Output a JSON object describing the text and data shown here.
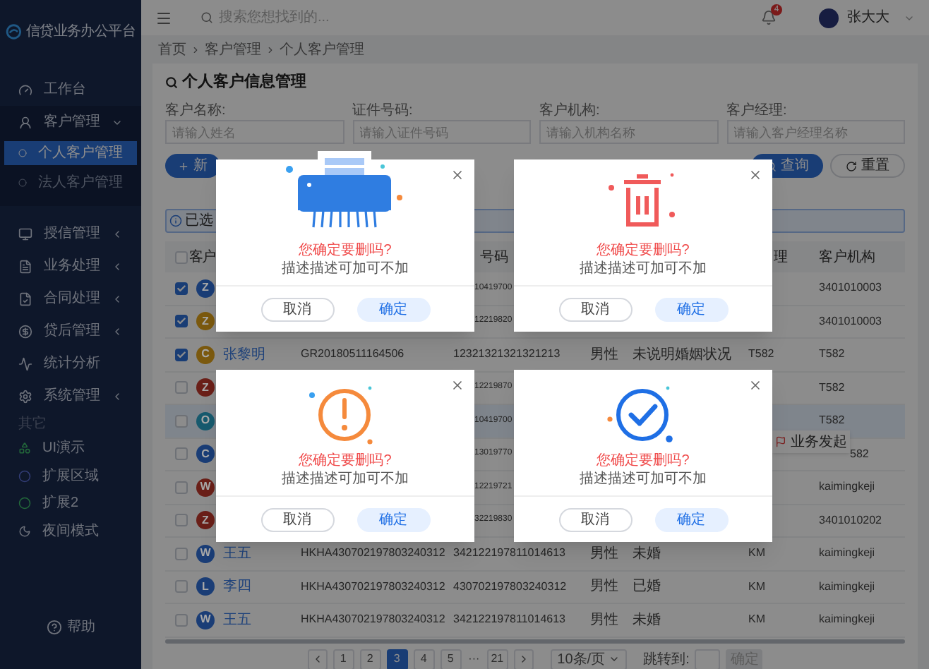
{
  "sidebar": {
    "logo_text": "信贷业务办公平台",
    "items": [
      {
        "label": "工作台",
        "kind": "link",
        "selected": false
      },
      {
        "label": "客户管理",
        "kind": "group",
        "expanded": true,
        "selected": false,
        "children": [
          {
            "label": "个人客户管理",
            "selected": true
          },
          {
            "label": "法人客户管理",
            "selected": false
          }
        ]
      },
      {
        "label": "授信管理",
        "kind": "group",
        "expanded": false,
        "selected": false
      },
      {
        "label": "业务处理",
        "kind": "group",
        "expanded": false,
        "selected": false
      },
      {
        "label": "合同处理",
        "kind": "group",
        "expanded": false,
        "selected": false
      },
      {
        "label": "贷后管理",
        "kind": "group",
        "expanded": false,
        "selected": false
      },
      {
        "label": "统计分析",
        "kind": "link",
        "selected": false
      },
      {
        "label": "系统管理",
        "kind": "group",
        "expanded": false,
        "selected": false
      }
    ],
    "section_title": "其它",
    "extra_items": [
      {
        "label": "UI演示"
      },
      {
        "label": "扩展区域"
      },
      {
        "label": "扩展2"
      },
      {
        "label": "夜间模式"
      }
    ],
    "help": "帮助"
  },
  "header": {
    "search_placeholder": "搜索您想找到的...",
    "notification_count": "4",
    "user_name": "张大大"
  },
  "breadcrumb": [
    "首页",
    "客户管理",
    "个人客户管理"
  ],
  "page_title": "个人客户信息管理",
  "filters": [
    {
      "label": "客户名称:",
      "placeholder": "请输入姓名"
    },
    {
      "label": "证件号码:",
      "placeholder": "请输入证件号码"
    },
    {
      "label": "客户机构:",
      "placeholder": "请输入机构名称"
    },
    {
      "label": "客户经理:",
      "placeholder": "请输入客户经理名称"
    }
  ],
  "actions": {
    "add": "新",
    "query": "查询",
    "reset": "重置"
  },
  "alert": "已选",
  "table": {
    "header_checked": false,
    "columns": [
      {
        "label": "客户"
      },
      {
        "label": "号码"
      },
      {
        "label": "理"
      },
      {
        "label": "客户机构"
      }
    ],
    "rows": [
      {
        "checked": true,
        "highlighted": false,
        "avatar": "Z",
        "color": "#1a3d76",
        "cert_tail": "10419700",
        "org": "3401010003"
      },
      {
        "checked": true,
        "highlighted": false,
        "avatar": "Z",
        "color": "#7b590e",
        "cert_tail": "12219820",
        "org": "3401010003"
      },
      {
        "checked": true,
        "highlighted": false,
        "avatar": "C",
        "color": "#7b590e",
        "name": "张黎明",
        "id_no": "GR20180511164506",
        "cert": "12321321321321213",
        "gender": "男性",
        "marital": "未说明婚姻状况",
        "manager": "T582",
        "org": "T582"
      },
      {
        "checked": false,
        "highlighted": false,
        "avatar": "Z",
        "color": "#6a1f18",
        "cert_tail": "12219870",
        "org": "T582"
      },
      {
        "checked": false,
        "highlighted": true,
        "avatar": "O",
        "color": "#175a6e",
        "cert_tail": "10419700",
        "org": "T582"
      },
      {
        "checked": false,
        "highlighted": false,
        "avatar": "C",
        "color": "#1a3d76",
        "cert_tail": "13019770",
        "org_tail": "582"
      },
      {
        "checked": false,
        "highlighted": false,
        "avatar": "W",
        "color": "#6a1f18",
        "cert_tail": "12219721",
        "org": "kaimingkeji"
      },
      {
        "checked": false,
        "highlighted": false,
        "avatar": "Z",
        "color": "#6a1f18",
        "cert_tail": "32219830",
        "org": "3401010202"
      },
      {
        "checked": false,
        "highlighted": false,
        "avatar": "W",
        "color": "#1a3d76",
        "name": "王五",
        "id_no": "HKHA430702197803240312",
        "cert": "342122197811014613",
        "gender": "男性",
        "marital": "未婚",
        "manager": "KM",
        "org": "kaimingkeji"
      },
      {
        "checked": false,
        "highlighted": false,
        "avatar": "L",
        "color": "#1a3d76",
        "name": "李四",
        "id_no": "HKHA430702197803240312",
        "cert": "430702197803240312",
        "gender": "男性",
        "marital": "已婚",
        "manager": "KM",
        "org": "kaimingkeji"
      },
      {
        "checked": false,
        "highlighted": false,
        "avatar": "W",
        "color": "#1a3d76",
        "name": "王五",
        "id_no": "HKHA430702197803240312",
        "cert": "342122197811014613",
        "gender": "男性",
        "marital": "未婚",
        "manager": "KM",
        "org": "kaimingkeji"
      }
    ]
  },
  "popover": {
    "label": "业务发起"
  },
  "pagination": {
    "pages": [
      {
        "label": "1",
        "kind": "page",
        "selected": false
      },
      {
        "label": "2",
        "kind": "page",
        "selected": false
      },
      {
        "label": "3",
        "kind": "page",
        "selected": true
      },
      {
        "label": "4",
        "kind": "page",
        "selected": false
      },
      {
        "label": "5",
        "kind": "page",
        "selected": false
      },
      {
        "label": "···",
        "kind": "ellipsis",
        "selected": false
      },
      {
        "label": "21",
        "kind": "page",
        "selected": false
      }
    ],
    "page_size": "10条/页",
    "jump_label": "跳转到:",
    "jump_button": "确定"
  },
  "dialogs": [
    {
      "kind": "shredder",
      "title": "您确定要删吗?",
      "description": "描述描述可加可不加",
      "cancel": "取消",
      "confirm": "确定"
    },
    {
      "kind": "trash",
      "title": "您确定要删吗?",
      "description": "描述描述可加可不加",
      "cancel": "取消",
      "confirm": "确定"
    },
    {
      "kind": "warning",
      "title": "您确定要删吗?",
      "description": "描述描述可加可不加",
      "cancel": "取消",
      "confirm": "确定"
    },
    {
      "kind": "success",
      "title": "您确定要删吗?",
      "description": "描述描述可加可不加",
      "cancel": "取消",
      "confirm": "确定"
    }
  ]
}
